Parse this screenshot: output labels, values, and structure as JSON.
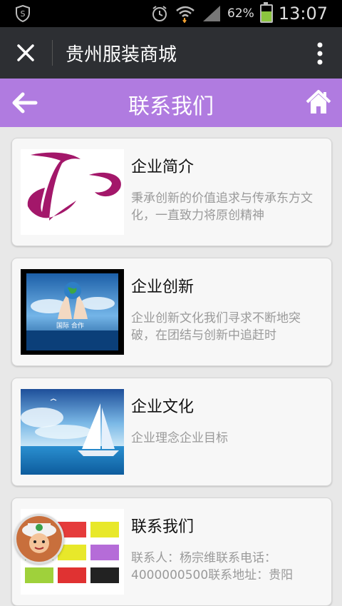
{
  "status_bar": {
    "battery_percent_label": "62%",
    "battery_level": 0.62,
    "time": "13:07",
    "icons": [
      "shield-s-icon",
      "alarm-icon",
      "wifi-icon",
      "signal-icon",
      "battery-icon"
    ]
  },
  "app_bar": {
    "title": "贵州服装商城",
    "close_icon": "close-icon",
    "menu_icon": "more-vert-icon"
  },
  "header": {
    "title": "联系我们",
    "back_icon": "arrow-left-icon",
    "home_icon": "home-icon",
    "color": "#b07be0"
  },
  "items": [
    {
      "title": "企业简介",
      "desc": "秉承创新的价值追求与传承东方文化，一直致力将原创精神",
      "thumb": "logo-image"
    },
    {
      "title": "企业创新",
      "desc": "企业创新文化我们寻求不断地突破，在团结与创新中追赶时",
      "thumb": "globe-hands-image"
    },
    {
      "title": "企业文化",
      "desc": "企业理念企业目标",
      "thumb": "sailboat-image"
    },
    {
      "title": "联系我们",
      "desc": "联系人：杨宗维联系电话：4000000500联系地址：贵阳",
      "thumb": "contact-tiles-image"
    }
  ]
}
